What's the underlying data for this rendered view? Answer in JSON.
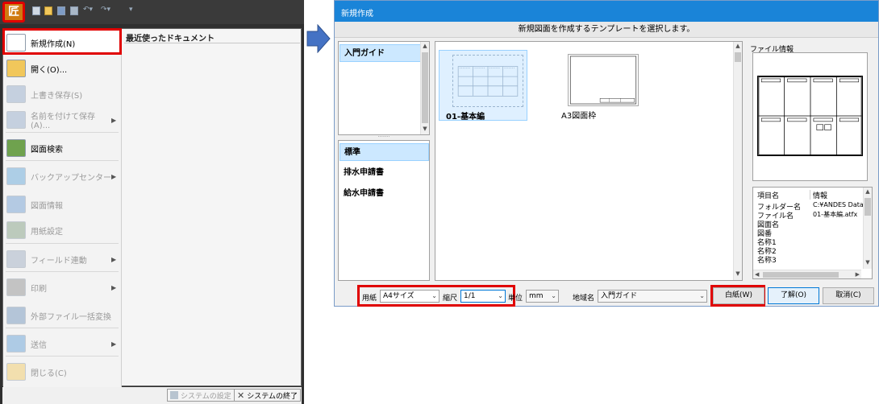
{
  "app_menu": {
    "app_button_glyph": "匠",
    "recent_header": "最近使ったドキュメント",
    "items": [
      {
        "label": "新規作成(N)",
        "enabled": true,
        "submenu": false,
        "icon": "new-document-icon"
      },
      {
        "label": "開く(O)...",
        "enabled": true,
        "submenu": false,
        "icon": "open-folder-icon"
      },
      {
        "label": "上書き保存(S)",
        "enabled": false,
        "submenu": false,
        "icon": "save-icon"
      },
      {
        "label": "名前を付けて保存(A)...",
        "enabled": false,
        "submenu": true,
        "icon": "save-as-icon"
      },
      {
        "label": "図面検索",
        "enabled": true,
        "submenu": false,
        "icon": "drawing-search-icon"
      },
      {
        "label": "バックアップセンター",
        "enabled": false,
        "submenu": true,
        "icon": "backup-center-icon"
      },
      {
        "label": "図面情報",
        "enabled": false,
        "submenu": false,
        "icon": "drawing-info-icon"
      },
      {
        "label": "用紙設定",
        "enabled": false,
        "submenu": false,
        "icon": "paper-settings-icon"
      },
      {
        "label": "フィールド連動",
        "enabled": false,
        "submenu": true,
        "icon": "field-link-icon"
      },
      {
        "label": "印刷",
        "enabled": false,
        "submenu": true,
        "icon": "printer-icon"
      },
      {
        "label": "外部ファイル一括変換",
        "enabled": false,
        "submenu": false,
        "icon": "batch-convert-icon"
      },
      {
        "label": "送信",
        "enabled": false,
        "submenu": true,
        "icon": "send-icon"
      },
      {
        "label": "閉じる(C)",
        "enabled": false,
        "submenu": false,
        "icon": "close-folder-icon"
      }
    ],
    "footer": {
      "system_settings": "システムの設定",
      "system_exit": "システムの終了"
    }
  },
  "dialog": {
    "title": "新規作成",
    "instruction": "新規図面を作成するテンプレートを選択します。",
    "categories": [
      "入門ガイド"
    ],
    "regions": [
      "標準",
      "排水申請書",
      "給水申請書"
    ],
    "templates": [
      {
        "label": "01-基本編",
        "selected": true
      },
      {
        "label": "A3図面枠",
        "selected": false
      }
    ],
    "file_info": {
      "title": "ファイル情報",
      "col_name": "項目名",
      "col_value": "情報",
      "rows": [
        {
          "name": "フォルダー名",
          "value": "C:¥ANDES Data"
        },
        {
          "name": "ファイル名",
          "value": "01-基本編.atfx"
        },
        {
          "name": "図面名",
          "value": ""
        },
        {
          "name": "図番",
          "value": ""
        },
        {
          "name": "名称1",
          "value": ""
        },
        {
          "name": "名称2",
          "value": ""
        },
        {
          "name": "名称3",
          "value": ""
        }
      ]
    },
    "paper_label": "用紙",
    "paper_value": "A4サイズ",
    "scale_label": "縮尺",
    "scale_value": "1/1",
    "unit_label": "単位",
    "unit_value": "mm",
    "region_label": "地域名",
    "region_value": "入門ガイド",
    "blank_button": "白紙(W)",
    "ok_button": "了解(O)",
    "cancel_button": "取消(C)"
  },
  "colors": {
    "highlight": "#e00000",
    "title_bar": "#1a84d8",
    "selection": "#cce8ff"
  }
}
